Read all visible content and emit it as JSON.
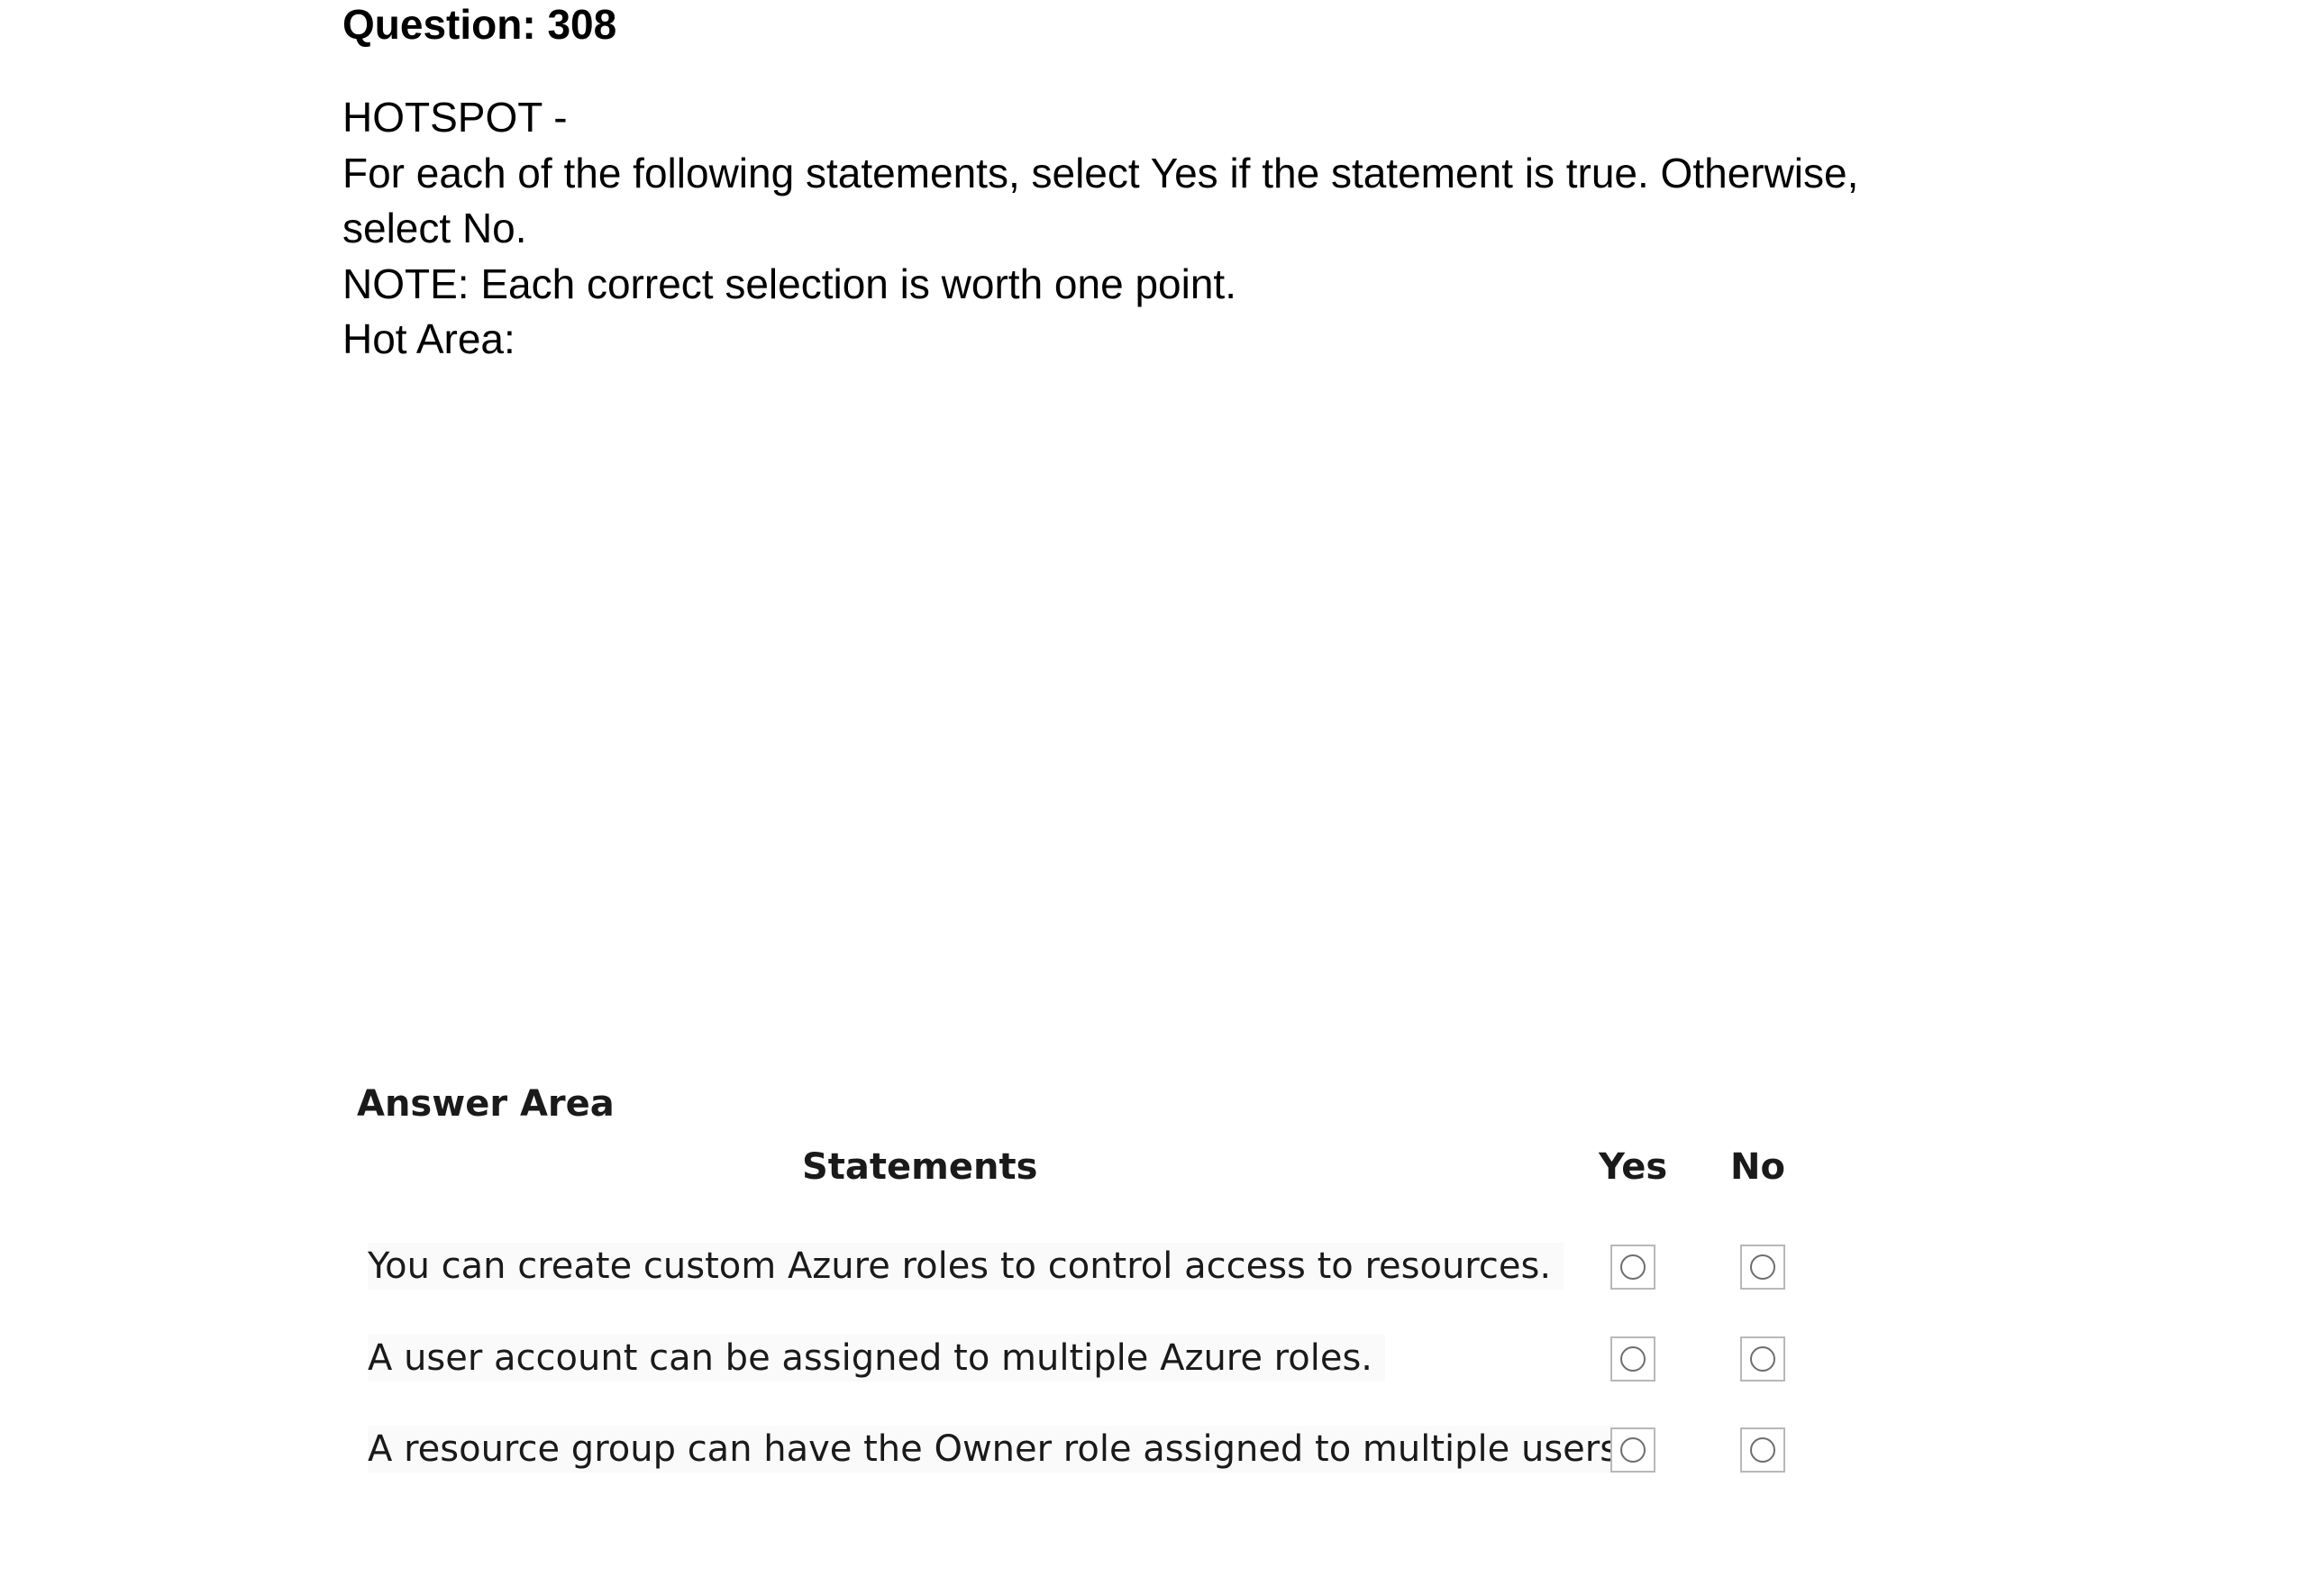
{
  "question": {
    "title": "Question: 308",
    "lines": [
      "HOTSPOT -",
      "For each of the following statements, select Yes if the statement is true. Otherwise,",
      "select No.",
      "NOTE: Each correct selection is worth one point.",
      "Hot Area:"
    ]
  },
  "answer_area": {
    "title": "Answer Area",
    "headers": {
      "statements": "Statements",
      "yes": "Yes",
      "no": "No"
    },
    "rows": [
      {
        "statement": "You can create custom Azure roles to control access to resources."
      },
      {
        "statement": "A user account can be assigned to multiple Azure roles."
      },
      {
        "statement": "A resource group can have the Owner role assigned to multiple users."
      }
    ]
  }
}
